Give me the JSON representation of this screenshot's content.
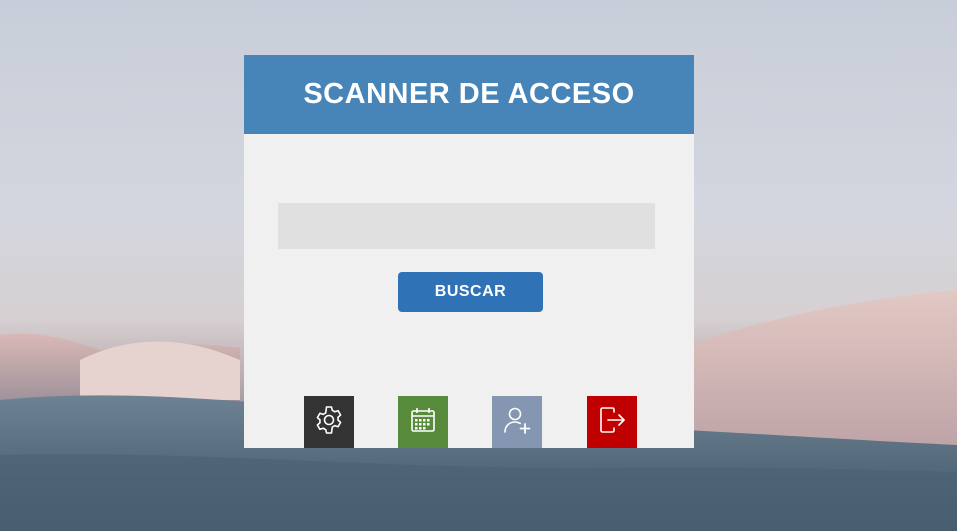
{
  "header": {
    "title": "SCANNER DE ACCESO"
  },
  "search": {
    "value": "",
    "placeholder": ""
  },
  "actions": {
    "search_label": "BUSCAR",
    "buttons": [
      {
        "icon": "gear-icon",
        "color": "#333333"
      },
      {
        "icon": "calendar-icon",
        "color": "#578a3a"
      },
      {
        "icon": "add-user-icon",
        "color": "#8496b1"
      },
      {
        "icon": "logout-icon",
        "color": "#c00000"
      }
    ]
  },
  "colors": {
    "header_bg": "#4785b9",
    "panel_bg": "#f0f0f0",
    "search_button": "#2f72b5"
  }
}
